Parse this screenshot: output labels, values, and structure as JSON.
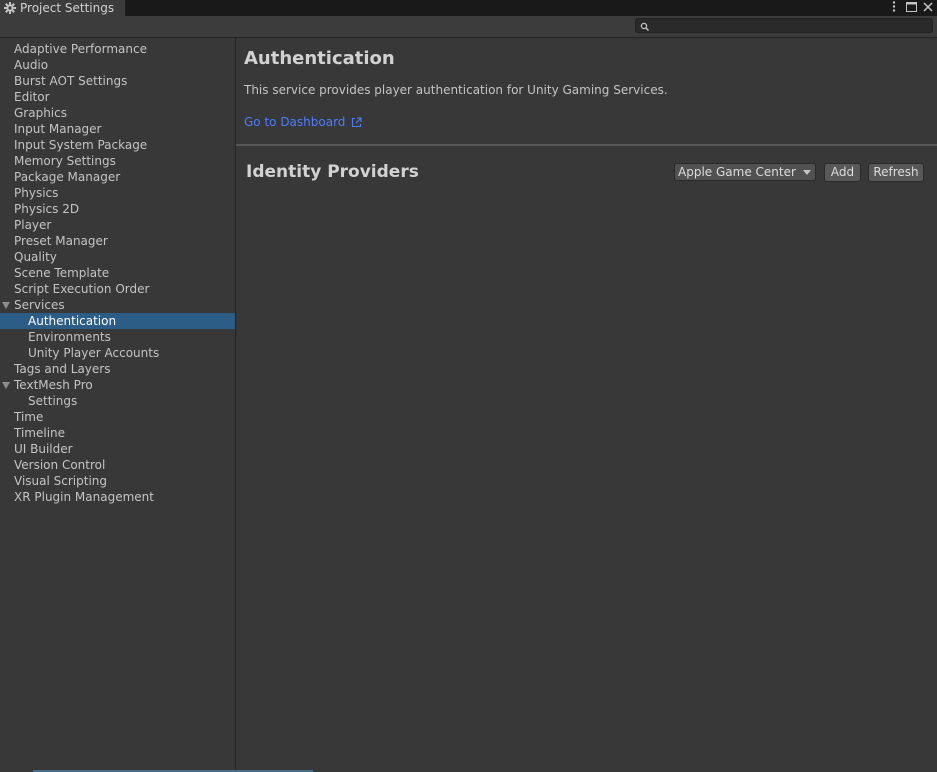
{
  "window": {
    "title": "Project Settings",
    "controls": [
      "kebab-menu-icon",
      "maximize-icon",
      "close-icon"
    ]
  },
  "search": {
    "placeholder": "",
    "value": ""
  },
  "sidebar": {
    "items": [
      {
        "label": "Adaptive Performance",
        "indent": 0
      },
      {
        "label": "Audio",
        "indent": 0
      },
      {
        "label": "Burst AOT Settings",
        "indent": 0
      },
      {
        "label": "Editor",
        "indent": 0
      },
      {
        "label": "Graphics",
        "indent": 0
      },
      {
        "label": "Input Manager",
        "indent": 0
      },
      {
        "label": "Input System Package",
        "indent": 0
      },
      {
        "label": "Memory Settings",
        "indent": 0
      },
      {
        "label": "Package Manager",
        "indent": 0
      },
      {
        "label": "Physics",
        "indent": 0
      },
      {
        "label": "Physics 2D",
        "indent": 0
      },
      {
        "label": "Player",
        "indent": 0
      },
      {
        "label": "Preset Manager",
        "indent": 0
      },
      {
        "label": "Quality",
        "indent": 0
      },
      {
        "label": "Scene Template",
        "indent": 0
      },
      {
        "label": "Script Execution Order",
        "indent": 0
      },
      {
        "label": "Services",
        "indent": 0,
        "expanded": true
      },
      {
        "label": "Authentication",
        "indent": 1,
        "selected": true
      },
      {
        "label": "Environments",
        "indent": 1
      },
      {
        "label": "Unity Player Accounts",
        "indent": 1
      },
      {
        "label": "Tags and Layers",
        "indent": 0
      },
      {
        "label": "TextMesh Pro",
        "indent": 0,
        "expanded": true
      },
      {
        "label": "Settings",
        "indent": 1
      },
      {
        "label": "Time",
        "indent": 0
      },
      {
        "label": "Timeline",
        "indent": 0
      },
      {
        "label": "UI Builder",
        "indent": 0
      },
      {
        "label": "Version Control",
        "indent": 0
      },
      {
        "label": "Visual Scripting",
        "indent": 0
      },
      {
        "label": "XR Plugin Management",
        "indent": 0
      }
    ]
  },
  "main": {
    "title": "Authentication",
    "description": "This service provides player authentication for Unity Gaming Services.",
    "dashboard_link": "Go to Dashboard",
    "providers_heading": "Identity Providers",
    "provider_select": {
      "selected": "Apple Game Center"
    },
    "add_label": "Add",
    "refresh_label": "Refresh"
  },
  "colors": {
    "background": "#383838",
    "selection": "#2c5d87",
    "link": "#4c7eff",
    "titlebar": "#191919"
  }
}
